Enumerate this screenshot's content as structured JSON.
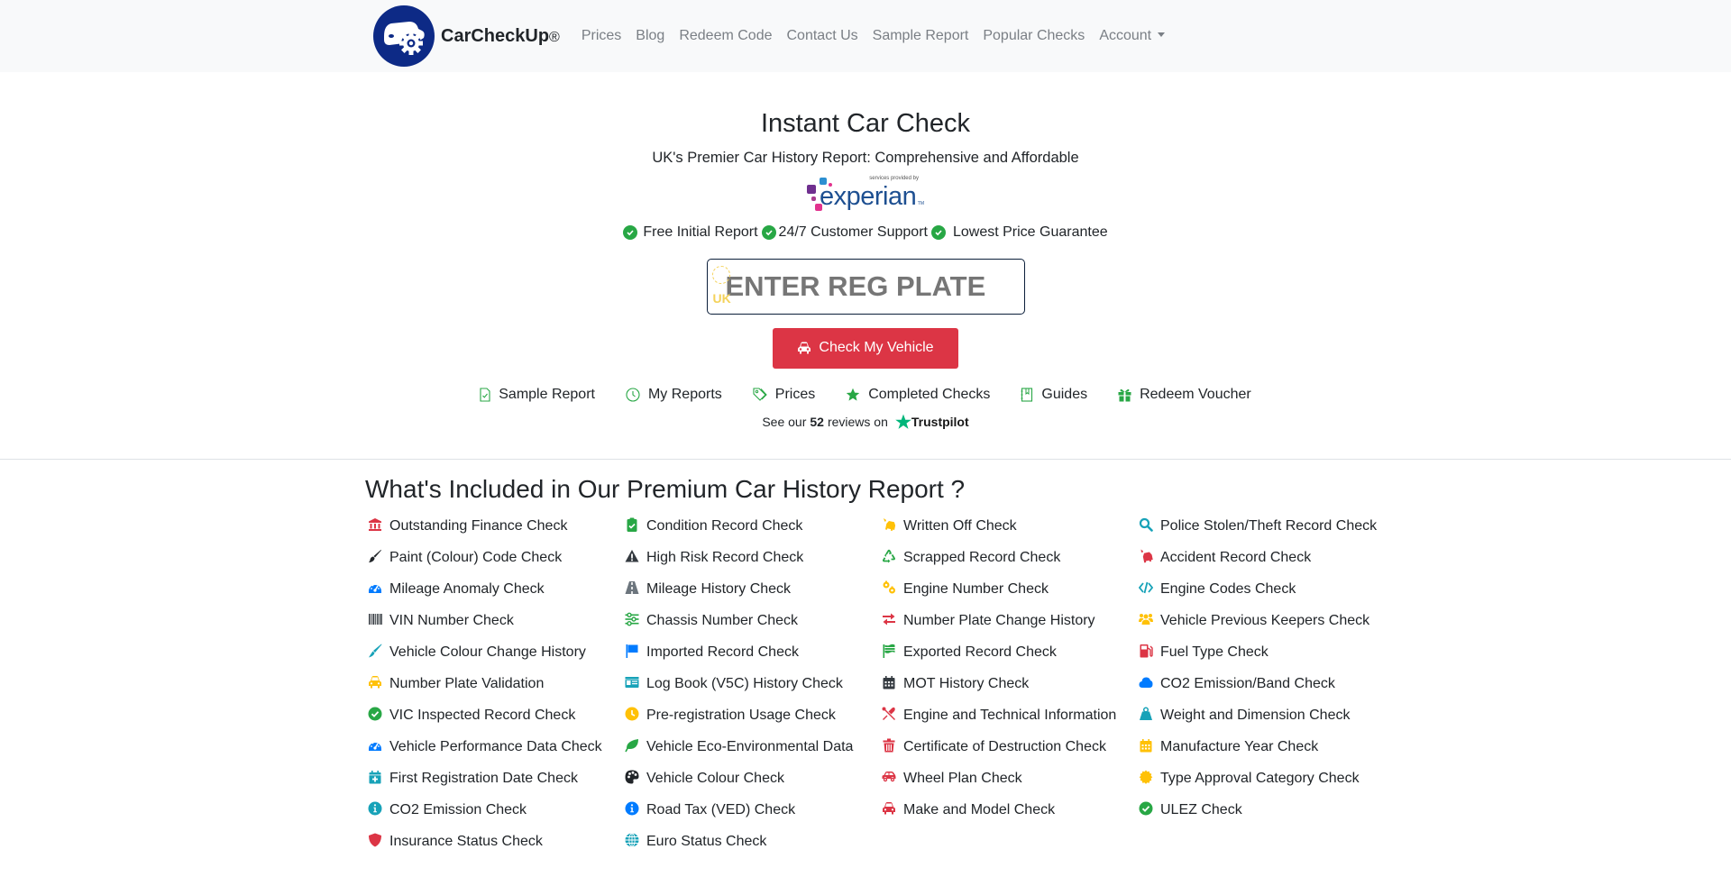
{
  "navbar": {
    "brand": "CarCheckUp",
    "brand_mark": "®",
    "links": [
      "Prices",
      "Blog",
      "Redeem Code",
      "Contact Us",
      "Sample Report",
      "Popular Checks",
      "Account"
    ]
  },
  "hero": {
    "title": "Instant Car Check",
    "subtitle": "UK's Premier Car History Report: Comprehensive and Affordable",
    "partner_tagline": "services provided by",
    "partner_name": "experian",
    "partner_tm": "TM",
    "features": [
      "Free Initial Report",
      "24/7 Customer Support",
      "Lowest Price Guarantee"
    ],
    "plate_country": "UK",
    "plate_placeholder": "ENTER REG PLATE",
    "plate_value": "",
    "check_button": "Check My Vehicle"
  },
  "quick_links": [
    {
      "label": "Sample Report",
      "icon": "file-check-icon"
    },
    {
      "label": "My Reports",
      "icon": "clock-icon"
    },
    {
      "label": "Prices",
      "icon": "tags-icon"
    },
    {
      "label": "Completed Checks",
      "icon": "star-icon"
    },
    {
      "label": "Guides",
      "icon": "book-icon"
    },
    {
      "label": "Redeem Voucher",
      "icon": "gift-icon"
    }
  ],
  "trustpilot": {
    "prefix": "See our",
    "count": "52",
    "suffix": "reviews on",
    "brand": "Trustpilot"
  },
  "included": {
    "title": "What's Included in Our Premium Car History Report ?",
    "items": [
      {
        "label": "Outstanding Finance Check",
        "icon": "bank-icon",
        "color": "#dc3545"
      },
      {
        "label": "Condition Record Check",
        "icon": "clipboard-check-icon",
        "color": "#28a745"
      },
      {
        "label": "Written Off Check",
        "icon": "car-burst-icon",
        "color": "#ffc107"
      },
      {
        "label": "Police Stolen/Theft Record Check",
        "icon": "search-icon",
        "color": "#17a2b8"
      },
      {
        "label": "Paint (Colour) Code Check",
        "icon": "paintbrush-icon",
        "color": "#212529"
      },
      {
        "label": "High Risk Record Check",
        "icon": "warning-icon",
        "color": "#343a40"
      },
      {
        "label": "Scrapped Record Check",
        "icon": "recycle-icon",
        "color": "#28a745"
      },
      {
        "label": "Accident Record Check",
        "icon": "car-crash-icon",
        "color": "#dc3545"
      },
      {
        "label": "Mileage Anomaly Check",
        "icon": "gauge-icon",
        "color": "#007bff"
      },
      {
        "label": "Mileage History Check",
        "icon": "road-icon",
        "color": "#6c757d"
      },
      {
        "label": "Engine Number Check",
        "icon": "cogs-icon",
        "color": "#ffc107"
      },
      {
        "label": "Engine Codes Check",
        "icon": "code-icon",
        "color": "#17a2b8"
      },
      {
        "label": "VIN Number Check",
        "icon": "barcode-icon",
        "color": "#343a40"
      },
      {
        "label": "Chassis Number Check",
        "icon": "sliders-icon",
        "color": "#28a745"
      },
      {
        "label": "Number Plate Change History",
        "icon": "exchange-icon",
        "color": "#dc3545"
      },
      {
        "label": "Vehicle Previous Keepers Check",
        "icon": "users-icon",
        "color": "#ffc107"
      },
      {
        "label": "Vehicle Colour Change History",
        "icon": "brush-icon",
        "color": "#17a2b8"
      },
      {
        "label": "Imported Record Check",
        "icon": "flag-icon",
        "color": "#007bff"
      },
      {
        "label": "Exported Record Check",
        "icon": "flag-checkered-icon",
        "color": "#28a745"
      },
      {
        "label": "Fuel Type Check",
        "icon": "gas-pump-icon",
        "color": "#dc3545"
      },
      {
        "label": "Number Plate Validation",
        "icon": "car-icon",
        "color": "#ffc107"
      },
      {
        "label": "Log Book (V5C) History Check",
        "icon": "id-card-icon",
        "color": "#17a2b8"
      },
      {
        "label": "MOT History Check",
        "icon": "calendar-icon",
        "color": "#343a40"
      },
      {
        "label": "CO2 Emission/Band Check",
        "icon": "cloud-icon",
        "color": "#007bff"
      },
      {
        "label": "VIC Inspected Record Check",
        "icon": "check-circle-icon",
        "color": "#28a745"
      },
      {
        "label": "Pre-registration Usage Check",
        "icon": "clock-icon",
        "color": "#ffc107"
      },
      {
        "label": "Engine and Technical Information",
        "icon": "tools-icon",
        "color": "#dc3545"
      },
      {
        "label": "Weight and Dimension Check",
        "icon": "weight-icon",
        "color": "#17a2b8"
      },
      {
        "label": "Vehicle Performance Data Check",
        "icon": "gauge-icon",
        "color": "#007bff"
      },
      {
        "label": "Vehicle Eco-Environmental Data",
        "icon": "leaf-icon",
        "color": "#28a745"
      },
      {
        "label": "Certificate of Destruction Check",
        "icon": "trash-icon",
        "color": "#dc3545"
      },
      {
        "label": "Manufacture Year Check",
        "icon": "calendar-icon",
        "color": "#ffc107"
      },
      {
        "label": "First Registration Date Check",
        "icon": "calendar-plus-icon",
        "color": "#17a2b8"
      },
      {
        "label": "Vehicle Colour Check",
        "icon": "palette-icon",
        "color": "#212529"
      },
      {
        "label": "Wheel Plan Check",
        "icon": "car-side-icon",
        "color": "#dc3545"
      },
      {
        "label": "Type Approval Category Check",
        "icon": "certificate-icon",
        "color": "#ffc107"
      },
      {
        "label": "CO2 Emission Check",
        "icon": "info-circle-icon",
        "color": "#17a2b8"
      },
      {
        "label": "Road Tax (VED) Check",
        "icon": "info-circle-icon",
        "color": "#007bff"
      },
      {
        "label": "Make and Model Check",
        "icon": "car-icon",
        "color": "#dc3545"
      },
      {
        "label": "ULEZ Check",
        "icon": "check-circle-icon",
        "color": "#28a745"
      },
      {
        "label": "Insurance Status Check",
        "icon": "shield-icon",
        "color": "#dc3545"
      },
      {
        "label": "Euro Status Check",
        "icon": "globe-icon",
        "color": "#17a2b8"
      }
    ]
  },
  "colors": {
    "brand_navy": "#0d2a86",
    "danger": "#dc3545",
    "success": "#28a745",
    "nav_bg": "#f8f9fa",
    "plate_blue": "#0e3a9b",
    "plate_yellow": "#f4d25a",
    "trustpilot_green": "#00b67a"
  }
}
